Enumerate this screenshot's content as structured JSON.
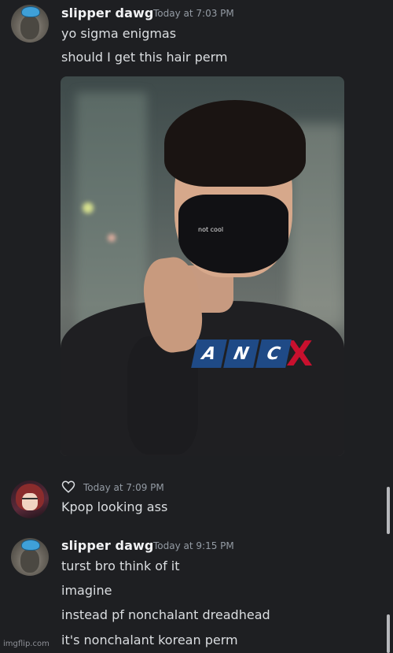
{
  "messages": [
    {
      "username": "slipper dawg",
      "timestamp": "Today at 7:03 PM",
      "lines": [
        "yo sigma enigmas",
        "should I get this hair perm"
      ],
      "attachment": {
        "mask_text": "not cool",
        "logo_letters": [
          "A",
          "N",
          "C"
        ],
        "logo_suffix": "X"
      }
    },
    {
      "username": "",
      "timestamp": "Today at 7:09 PM",
      "lines": [
        "Kpop looking ass"
      ]
    },
    {
      "username": "slipper dawg",
      "timestamp": "Today at 9:15 PM",
      "lines": [
        "turst bro think of it",
        "imagine",
        "instead pf nonchalant dreadhead",
        "it's nonchalant korean perm"
      ]
    }
  ],
  "watermark": "imgflip.com",
  "colors": {
    "background": "#1e1f22",
    "username": "#f2f3f5",
    "text": "#dbdee1",
    "timestamp": "#949ba4",
    "logo_blue": "#1f4a86",
    "logo_red": "#c8102e"
  },
  "icons": {
    "heart": "heart-outline-icon"
  }
}
